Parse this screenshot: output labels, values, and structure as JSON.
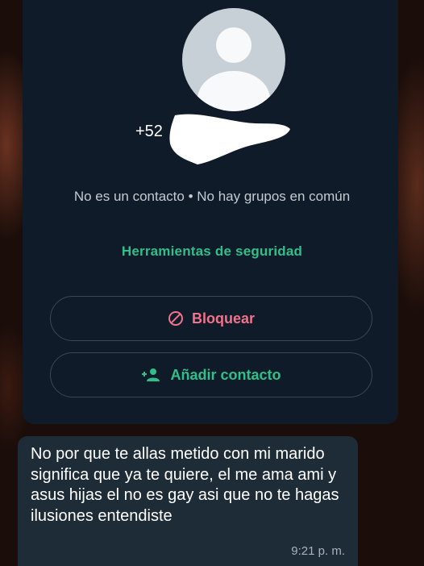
{
  "profile": {
    "phone_prefix": "+52",
    "status": "No es un contacto • No hay grupos en común",
    "security_link": "Herramientas de seguridad"
  },
  "actions": {
    "block_label": "Bloquear",
    "add_contact_label": "Añadir contacto"
  },
  "message": {
    "text": "No por que te allas metido con mi marido significa que ya te quiere, el me ama ami y asus hijas el no es gay asi que no te hagas ilusiones entendiste",
    "time": "9:21 p. m."
  },
  "colors": {
    "panel": "#0f1b28",
    "accent_green": "#2fbf8a",
    "danger_pink": "#f2728b",
    "bubble": "#1e2c37"
  },
  "icons": [
    "avatar-icon",
    "block-icon",
    "add-person-icon"
  ]
}
